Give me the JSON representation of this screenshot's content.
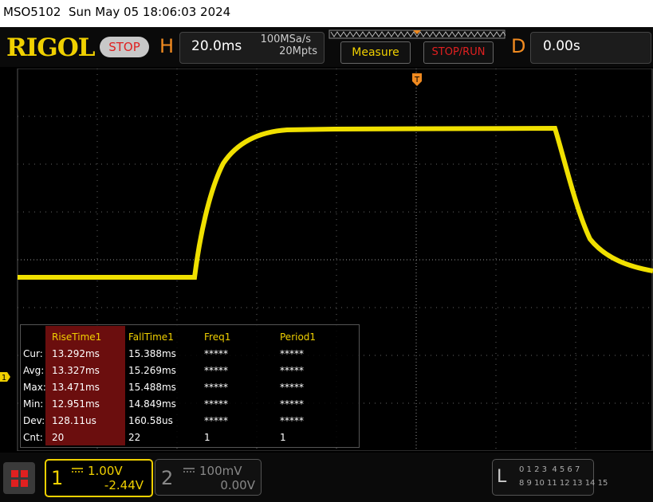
{
  "title_bar": "MSO5102  Sun May 05 18:06:03 2024",
  "logo": "RIGOL",
  "run_state": "STOP",
  "horizontal": {
    "letter": "H",
    "timebase": "20.0ms",
    "sample_rate": "100MSa/s",
    "memory_depth": "20Mpts"
  },
  "buttons": {
    "measure": "Measure",
    "stop_run": "STOP/RUN"
  },
  "delay": {
    "letter": "D",
    "value": "0.00s"
  },
  "trigger_marker": "T",
  "measurements": {
    "row_labels": [
      "Cur:",
      "Avg:",
      "Max:",
      "Min:",
      "Dev:",
      "Cnt:"
    ],
    "columns": [
      {
        "header": "RiseTime1",
        "values": [
          "13.292ms",
          "13.327ms",
          "13.471ms",
          "12.951ms",
          "128.11us",
          "20"
        ]
      },
      {
        "header": "FallTime1",
        "values": [
          "15.388ms",
          "15.269ms",
          "15.488ms",
          "14.849ms",
          "160.58us",
          "22"
        ]
      },
      {
        "header": "Freq1",
        "values": [
          "*****",
          "*****",
          "*****",
          "*****",
          "*****",
          "1"
        ]
      },
      {
        "header": "Period1",
        "values": [
          "*****",
          "*****",
          "*****",
          "*****",
          "*****",
          "1"
        ]
      }
    ]
  },
  "channel1": {
    "number": "1",
    "scale": "1.00V",
    "offset": "-2.44V",
    "color": "#f0d000",
    "marker": "1"
  },
  "channel2": {
    "number": "2",
    "scale": "100mV",
    "offset": "0.00V"
  },
  "logic": {
    "letter": "L",
    "row1": "0 1 2 3  4 5 6 7",
    "row2": "8 9 10 11 12 13 14 15"
  }
}
